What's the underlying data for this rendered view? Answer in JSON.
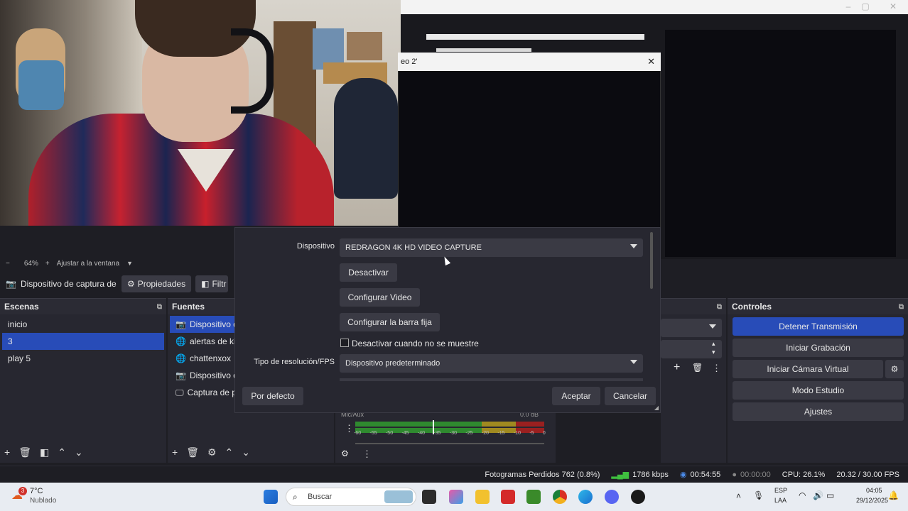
{
  "window": {
    "min": "–",
    "max": "▢",
    "close": "✕"
  },
  "dialog": {
    "title": "eo 2'",
    "close": "✕",
    "device_label": "Dispositivo",
    "device_value": "REDRAGON 4K HD VIDEO CAPTURE",
    "deactivate": "Desactivar",
    "configure_video": "Configurar Video",
    "configure_bar": "Configurar la barra fija",
    "hide_checkbox": "Desactivar cuando no se muestre",
    "resolution_label": "Tipo de resolución/FPS",
    "resolution_value": "Dispositivo predeterminado",
    "defaults": "Por defecto",
    "accept": "Aceptar",
    "cancel": "Cancelar"
  },
  "zoom": {
    "minus": "−",
    "value": "64%",
    "plus": "+",
    "fit": "Ajustar a la ventana"
  },
  "source_toolbar": {
    "source_name": "Dispositivo de captura de v",
    "properties": "Propiedades",
    "filters": "Filtr"
  },
  "scenes": {
    "title": "Escenas",
    "items": [
      "inicio",
      "3",
      "play 5"
    ],
    "selected_index": 1
  },
  "sources": {
    "title": "Fuentes",
    "items": [
      {
        "label": "Dispositivo de",
        "icon": "camera-icon"
      },
      {
        "label": "alertas de kick",
        "icon": "globe-icon"
      },
      {
        "label": "chattenxox",
        "icon": "globe-icon"
      },
      {
        "label": "Dispositivo de",
        "icon": "camera-icon"
      },
      {
        "label": "Captura de pa",
        "icon": "monitor-icon"
      }
    ]
  },
  "mixer": {
    "track": "Mic/Aux",
    "db": "0.0 dB",
    "scale": [
      "-60",
      "-55",
      "-50",
      "-45",
      "-40",
      "-35",
      "-30",
      "-25",
      "-20",
      "-15",
      "-10",
      "-5",
      "0"
    ]
  },
  "controls": {
    "title": "Controles",
    "stop_stream": "Detener Transmisión",
    "start_recording": "Iniciar Grabación",
    "start_virtual_cam": "Iniciar Cámara Virtual",
    "studio_mode": "Modo Estudio",
    "settings": "Ajustes"
  },
  "status": {
    "dropped_frames": "Fotogramas Perdidos 762 (0.8%)",
    "bitrate": "1786 kbps",
    "stream_time": "00:54:55",
    "rec_time": "00:00:00",
    "cpu": "CPU: 26.1%",
    "fps": "20.32 / 30.00 FPS"
  },
  "taskbar": {
    "weather_temp": "7°C",
    "weather_desc": "Nublado",
    "weather_badge": "3",
    "search_placeholder": "Buscar",
    "lang1": "ESP",
    "lang2": "LAA",
    "time": "04:05",
    "date": "29/12/2025"
  },
  "colors": {
    "accent": "#284cb8",
    "panel": "#272730",
    "button": "#3a3a44",
    "bg": "#1e1e24"
  }
}
